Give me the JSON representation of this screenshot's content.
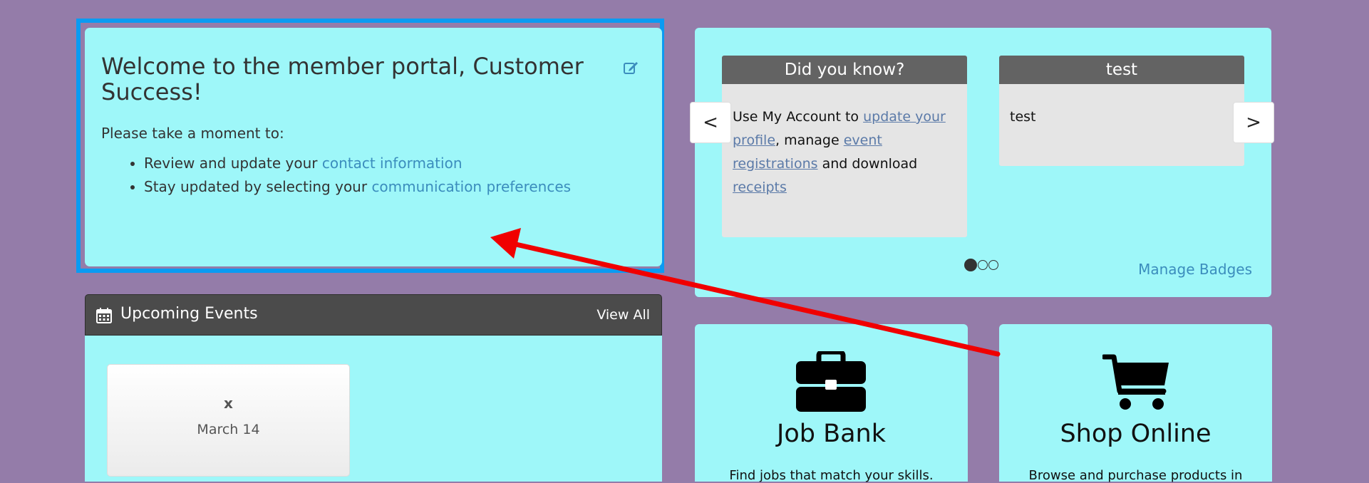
{
  "welcome": {
    "title": "Welcome to the member portal, Customer Success!",
    "intro": "Please take a moment to:",
    "items": [
      {
        "prefix": "Review and update your ",
        "link": "contact information"
      },
      {
        "prefix": "Stay updated by selecting your ",
        "link": "communication preferences"
      }
    ],
    "edit_icon": "edit-icon"
  },
  "events": {
    "title": "Upcoming Events",
    "view_all": "View All",
    "icon": "calendar-icon",
    "items": [
      {
        "title": "x",
        "date": "March 14"
      }
    ]
  },
  "badges": {
    "prev_label": "<",
    "next_label": ">",
    "cards": [
      {
        "title": "Did you know?",
        "text_1": "Use My Account to ",
        "link_1": "update your profile",
        "text_2": ", manage ",
        "link_2": "event registrations",
        "text_3": " and download ",
        "link_3": "receipts"
      },
      {
        "title": "test",
        "body": "test"
      }
    ],
    "dots": 3,
    "active_dot": 0,
    "manage_label": "Manage Badges"
  },
  "tiles": [
    {
      "title": "Job Bank",
      "description": "Find jobs that match your skills.",
      "icon": "briefcase-icon"
    },
    {
      "title": "Shop Online",
      "description": "Browse and purchase products in",
      "icon": "shopping-cart-icon"
    }
  ],
  "colors": {
    "background": "#947ca9",
    "panel": "#9ef7f9",
    "highlight_border": "#0a9bf2",
    "annotation_arrow": "#f00000",
    "link": "#3b8dbd"
  }
}
